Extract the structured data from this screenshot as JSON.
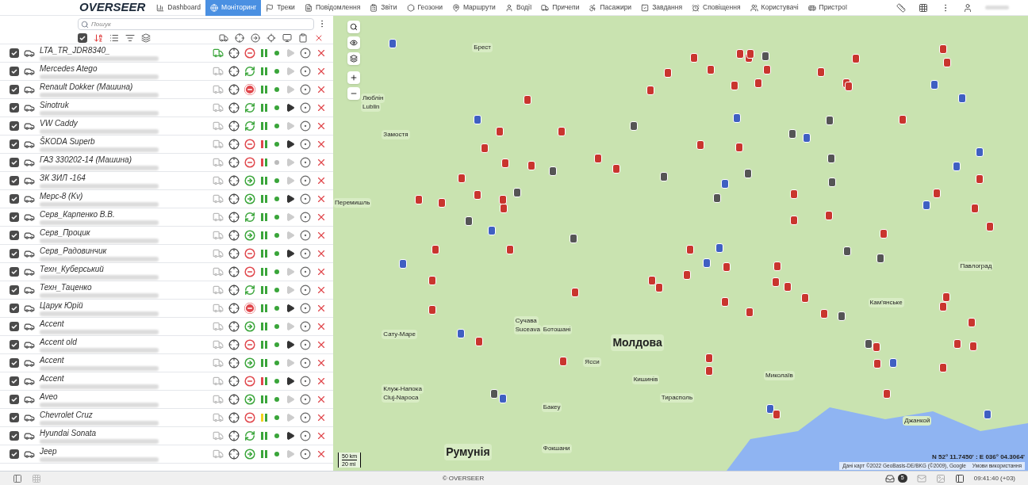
{
  "nav": {
    "logo": "OVERSEER",
    "items": [
      {
        "label": "Dashboard",
        "selected": false
      },
      {
        "label": "Моніторинг",
        "selected": true
      },
      {
        "label": "Треки",
        "selected": false
      },
      {
        "label": "Повідомлення",
        "selected": false
      },
      {
        "label": "Звіти",
        "selected": false
      },
      {
        "label": "Геозони",
        "selected": false
      },
      {
        "label": "Маршрути",
        "selected": false
      },
      {
        "label": "Водії",
        "selected": false
      },
      {
        "label": "Причепи",
        "selected": false
      },
      {
        "label": "Пасажири",
        "selected": false
      },
      {
        "label": "Завдання",
        "selected": false
      },
      {
        "label": "Сповіщення",
        "selected": false
      },
      {
        "label": "Користувачі",
        "selected": false
      },
      {
        "label": "Пристрої",
        "selected": false
      }
    ]
  },
  "sidebar": {
    "search": {
      "placeholder": "Пошук"
    },
    "all_checked": true,
    "units": [
      {
        "name": "LTA_TR_JDR8340_",
        "checked": true,
        "tracked": true,
        "stopped": true,
        "parked": false,
        "alarm": false,
        "power_alert": false,
        "power_low": false,
        "online": true,
        "gps": false
      },
      {
        "name": "Mercedes Atego",
        "checked": true,
        "tracked": false,
        "stopped": false,
        "parked": true,
        "alarm": false,
        "power_alert": false,
        "power_low": false,
        "online": true,
        "gps": false
      },
      {
        "name": "Renault Dokker (Машина)",
        "checked": true,
        "tracked": false,
        "stopped": false,
        "parked": false,
        "alarm": true,
        "power_alert": false,
        "power_low": false,
        "online": true,
        "gps": false
      },
      {
        "name": "Sinotruk",
        "checked": true,
        "tracked": false,
        "stopped": false,
        "parked": true,
        "alarm": false,
        "power_alert": false,
        "power_low": false,
        "online": true,
        "gps": true
      },
      {
        "name": "VW Caddy",
        "checked": true,
        "tracked": false,
        "stopped": false,
        "parked": true,
        "alarm": false,
        "power_alert": false,
        "power_low": false,
        "online": true,
        "gps": false
      },
      {
        "name": "ŠKODA Superb",
        "checked": true,
        "tracked": false,
        "stopped": true,
        "parked": false,
        "alarm": false,
        "power_alert": true,
        "power_low": false,
        "online": true,
        "gps": true
      },
      {
        "name": "ГАЗ 330202-14 (Машина)",
        "checked": true,
        "tracked": false,
        "stopped": true,
        "parked": false,
        "alarm": false,
        "power_alert": true,
        "power_low": false,
        "online": false,
        "gps": false
      },
      {
        "name": "ЗК ЗИЛ -164",
        "checked": true,
        "tracked": false,
        "stopped": false,
        "parked": false,
        "alarm": false,
        "power_alert": false,
        "power_low": false,
        "online": true,
        "gps": false
      },
      {
        "name": "Мерс-8 (Kv)",
        "checked": true,
        "tracked": false,
        "stopped": false,
        "parked": false,
        "alarm": false,
        "power_alert": false,
        "power_low": false,
        "online": true,
        "gps": true
      },
      {
        "name": "Серв_Карпенко В.В.",
        "checked": true,
        "tracked": false,
        "stopped": false,
        "parked": true,
        "alarm": false,
        "power_alert": false,
        "power_low": false,
        "online": true,
        "gps": false
      },
      {
        "name": "Серв_Процик",
        "checked": true,
        "tracked": false,
        "stopped": false,
        "parked": false,
        "alarm": false,
        "power_alert": false,
        "power_low": false,
        "online": true,
        "gps": false
      },
      {
        "name": "Серв_Радовинчик",
        "checked": true,
        "tracked": false,
        "stopped": true,
        "parked": false,
        "alarm": false,
        "power_alert": false,
        "power_low": false,
        "online": true,
        "gps": true
      },
      {
        "name": "Техн_Куберський",
        "checked": true,
        "tracked": false,
        "stopped": true,
        "parked": false,
        "alarm": false,
        "power_alert": false,
        "power_low": false,
        "online": true,
        "gps": false
      },
      {
        "name": "Техн_Таценко",
        "checked": true,
        "tracked": false,
        "stopped": false,
        "parked": true,
        "alarm": false,
        "power_alert": false,
        "power_low": false,
        "online": true,
        "gps": false
      },
      {
        "name": "Царук Юрій",
        "checked": true,
        "tracked": false,
        "stopped": false,
        "parked": false,
        "alarm": true,
        "power_alert": false,
        "power_low": false,
        "online": true,
        "gps": true
      },
      {
        "name": "Accent",
        "checked": true,
        "tracked": false,
        "stopped": false,
        "parked": false,
        "alarm": false,
        "power_alert": false,
        "power_low": false,
        "online": true,
        "gps": false
      },
      {
        "name": "Accent old",
        "checked": true,
        "tracked": false,
        "stopped": true,
        "parked": false,
        "alarm": false,
        "power_alert": false,
        "power_low": false,
        "online": true,
        "gps": true
      },
      {
        "name": "Accent",
        "checked": true,
        "tracked": false,
        "stopped": false,
        "parked": false,
        "alarm": false,
        "power_alert": false,
        "power_low": false,
        "online": true,
        "gps": false
      },
      {
        "name": "Accent",
        "checked": true,
        "tracked": false,
        "stopped": true,
        "parked": false,
        "alarm": false,
        "power_alert": true,
        "power_low": false,
        "online": true,
        "gps": true
      },
      {
        "name": "Aveo",
        "checked": true,
        "tracked": false,
        "stopped": false,
        "parked": false,
        "alarm": false,
        "power_alert": false,
        "power_low": false,
        "online": true,
        "gps": false
      },
      {
        "name": "Chevrolet Cruz",
        "checked": true,
        "tracked": false,
        "stopped": true,
        "parked": false,
        "alarm": false,
        "power_alert": false,
        "power_low": true,
        "online": true,
        "gps": false
      },
      {
        "name": "Hyundai Sonata",
        "checked": true,
        "tracked": false,
        "stopped": false,
        "parked": true,
        "alarm": false,
        "power_alert": false,
        "power_low": false,
        "online": true,
        "gps": true
      },
      {
        "name": "Jeep",
        "checked": true,
        "tracked": false,
        "stopped": false,
        "parked": false,
        "alarm": false,
        "power_alert": false,
        "power_low": false,
        "online": true,
        "gps": false
      }
    ]
  },
  "map": {
    "labels": [
      {
        "text": "Брест",
        "kind": "city"
      },
      {
        "text": "Люблін",
        "kind": "city"
      },
      {
        "text": "Lublin",
        "kind": "city"
      },
      {
        "text": "Замостя",
        "kind": "city"
      },
      {
        "text": "Перемишль",
        "kind": "city"
      },
      {
        "text": "Сату-Маре",
        "kind": "city"
      },
      {
        "text": "Клуж-Напока",
        "kind": "city"
      },
      {
        "text": "Cluj-Napoca",
        "kind": "city"
      },
      {
        "text": "Сучава",
        "kind": "city"
      },
      {
        "text": "Suceava",
        "kind": "city"
      },
      {
        "text": "Ботошані",
        "kind": "city"
      },
      {
        "text": "Молдова",
        "kind": "country"
      },
      {
        "text": "Ясси",
        "kind": "city"
      },
      {
        "text": "Кишинів",
        "kind": "city"
      },
      {
        "text": "Тирасполь",
        "kind": "city"
      },
      {
        "text": "Бакеу",
        "kind": "city"
      },
      {
        "text": "Румунія",
        "kind": "country"
      },
      {
        "text": "Фокшани",
        "kind": "city"
      },
      {
        "text": "Миколаїв",
        "kind": "city"
      },
      {
        "text": "Кам'янське",
        "kind": "city"
      },
      {
        "text": "Павлоград",
        "kind": "city"
      },
      {
        "text": "Джанкой",
        "kind": "city"
      }
    ],
    "scale_km": "50 km",
    "scale_mi": "20 mi",
    "coordinates": "N 52° 11.7450' : E 036° 04.3064'",
    "attribution": "Дані карт ©2022 GeoBasis-DE/BKG (©2009), Google",
    "terms": "Умови використання"
  },
  "footer": {
    "copyright": "© OVERSEER",
    "messages_count": "5",
    "time": "09:41:40 (+03)"
  }
}
